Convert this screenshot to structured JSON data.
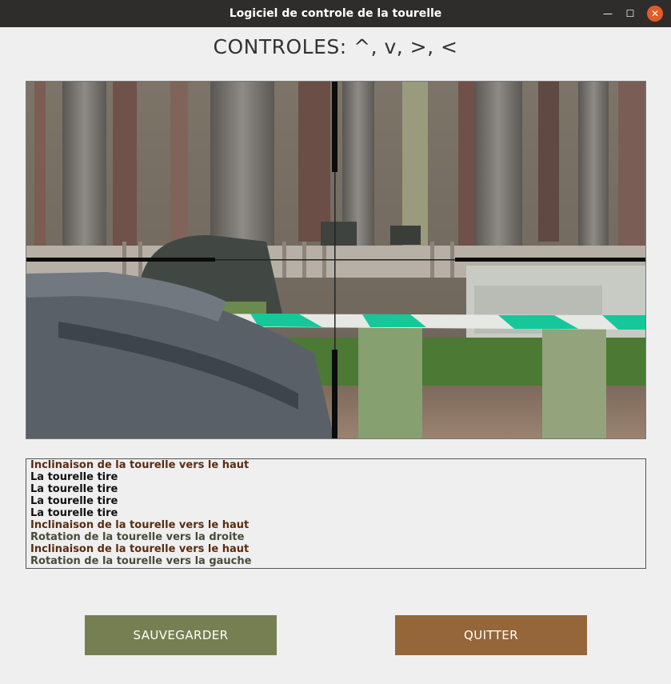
{
  "window": {
    "title": "Logiciel de controle de la tourelle",
    "minimize_glyph": "—",
    "maximize_glyph": "☐",
    "close_glyph": "✕"
  },
  "header": {
    "controls_text": "CONTROLES: ^, v, >, <"
  },
  "video": {
    "scene": "forest-with-barrier-and-crosshair"
  },
  "log": {
    "lines": [
      {
        "text": "Inclinaison de la tourelle vers le haut",
        "color": "#5a2c10"
      },
      {
        "text": "La tourelle tire",
        "color": "#111111"
      },
      {
        "text": "La tourelle tire",
        "color": "#111111"
      },
      {
        "text": "La tourelle tire",
        "color": "#111111"
      },
      {
        "text": "La tourelle tire",
        "color": "#111111"
      },
      {
        "text": "Inclinaison de la tourelle vers le haut",
        "color": "#5a2c10"
      },
      {
        "text": "Rotation de la tourelle vers la droite",
        "color": "#4a4a3a"
      },
      {
        "text": "Inclinaison de la tourelle vers le haut",
        "color": "#5a2c10"
      },
      {
        "text": "Rotation de la tourelle vers la gauche",
        "color": "#4a4a3a"
      }
    ]
  },
  "buttons": {
    "save_label": "SAUVEGARDER",
    "quit_label": "QUITTER",
    "save_color": "#767f52",
    "quit_color": "#94663a"
  }
}
